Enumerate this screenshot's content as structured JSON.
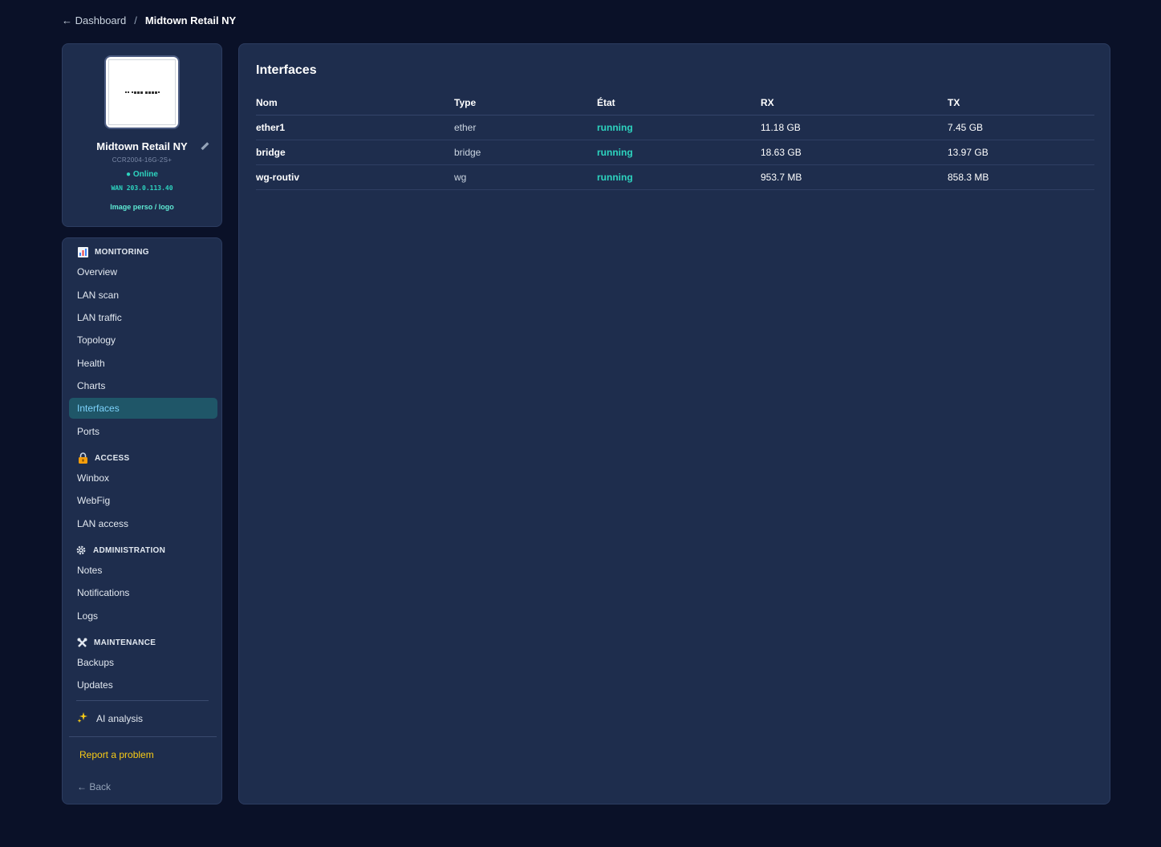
{
  "breadcrumb": {
    "back_label": "← Dashboard",
    "separator": "/",
    "current": "Midtown Retail NY"
  },
  "device": {
    "name": "Midtown Retail NY",
    "model": "CCR2004-16G-2S+",
    "status": "● Online",
    "wan": "WAN 203.0.113.40",
    "logo_link": "Image perso / logo",
    "edit_icon": "pencil-icon"
  },
  "nav": {
    "monitoring": {
      "title": "MONITORING",
      "icon": "bar-chart-icon",
      "items": [
        "Overview",
        "LAN scan",
        "LAN traffic",
        "Topology",
        "Health",
        "Charts",
        "Interfaces",
        "Ports"
      ]
    },
    "access": {
      "title": "ACCESS",
      "icon": "lock-icon",
      "items": [
        "Winbox",
        "WebFig",
        "LAN access"
      ]
    },
    "administration": {
      "title": "ADMINISTRATION",
      "icon": "gear-icon",
      "items": [
        "Notes",
        "Notifications",
        "Logs"
      ]
    },
    "maintenance": {
      "title": "MAINTENANCE",
      "icon": "tools-icon",
      "items": [
        "Backups",
        "Updates"
      ]
    },
    "active_item": "Interfaces",
    "ai_analysis": "AI analysis",
    "ai_icon": "sparkles-icon",
    "report": "Report a problem",
    "back": "← Back"
  },
  "main": {
    "title": "Interfaces",
    "columns": [
      "Nom",
      "Type",
      "État",
      "RX",
      "TX"
    ],
    "rows": [
      {
        "name": "ether1",
        "type": "ether",
        "state": "running",
        "rx": "11.18 GB",
        "tx": "7.45 GB"
      },
      {
        "name": "bridge",
        "type": "bridge",
        "state": "running",
        "rx": "18.63 GB",
        "tx": "13.97 GB"
      },
      {
        "name": "wg-routiv",
        "type": "wg",
        "state": "running",
        "rx": "953.7 MB",
        "tx": "858.3 MB"
      }
    ]
  },
  "colors": {
    "background": "#0a1128",
    "card": "#1e2d4d",
    "accent": "#2dd4bf",
    "active_nav": "#1f5668",
    "report": "#facc15"
  }
}
